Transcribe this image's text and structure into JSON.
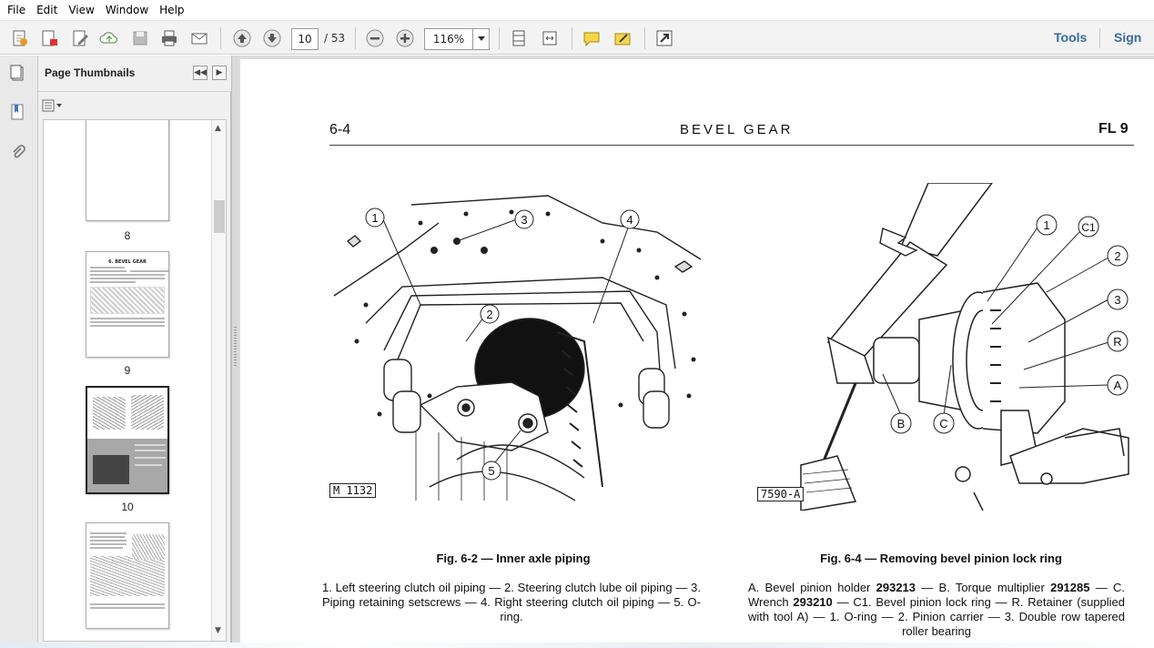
{
  "menu": [
    "File",
    "Edit",
    "View",
    "Window",
    "Help"
  ],
  "toolbar": {
    "current_page": "10",
    "page_total": "/ 53",
    "zoom": "116%",
    "tools_label": "Tools",
    "sign_label": "Sign"
  },
  "sidebar": {
    "title": "Page Thumbnails",
    "thumbnails": [
      {
        "label": "8"
      },
      {
        "label": "9",
        "heading": "6. BEVEL GEAR"
      },
      {
        "label": "10"
      },
      {
        "label": ""
      }
    ]
  },
  "document": {
    "header_left": "6-4",
    "header_center": "BEVEL GEAR",
    "header_right": "FL 9",
    "figure_left": {
      "tag": "M 1132",
      "callouts": [
        "1",
        "2",
        "3",
        "4",
        "5"
      ],
      "caption": "Fig. 6-2 — Inner axle piping",
      "legend": "1. Left steering clutch oil piping — 2. Steering clutch lube oil piping — 3. Piping retaining setscrews — 4. Right steering clutch oil piping — 5. O-ring."
    },
    "figure_right": {
      "tag": "7590-A",
      "callouts": [
        "1",
        "C1",
        "2",
        "3",
        "R",
        "A",
        "B",
        "C"
      ],
      "caption": "Fig. 6-4 — Removing bevel pinion lock ring",
      "legend_a": "A. Bevel pinion holder ",
      "legend_a_num": "293213",
      "legend_b": " — B. Torque multiplier ",
      "legend_b_num": "291285",
      "legend_c": " — C. Wrench ",
      "legend_c_num": "293210",
      "legend_rest": " — C1. Bevel pinion lock ring — R. Retainer (supplied with tool A) — 1. O-ring — 2. Pinion carrier — 3. Double row tapered roller bearing"
    }
  },
  "colors": {
    "link": "#3a6a9c",
    "toolbar_bg": "#f3f3f3",
    "panel_bg": "#f0f0f0"
  }
}
